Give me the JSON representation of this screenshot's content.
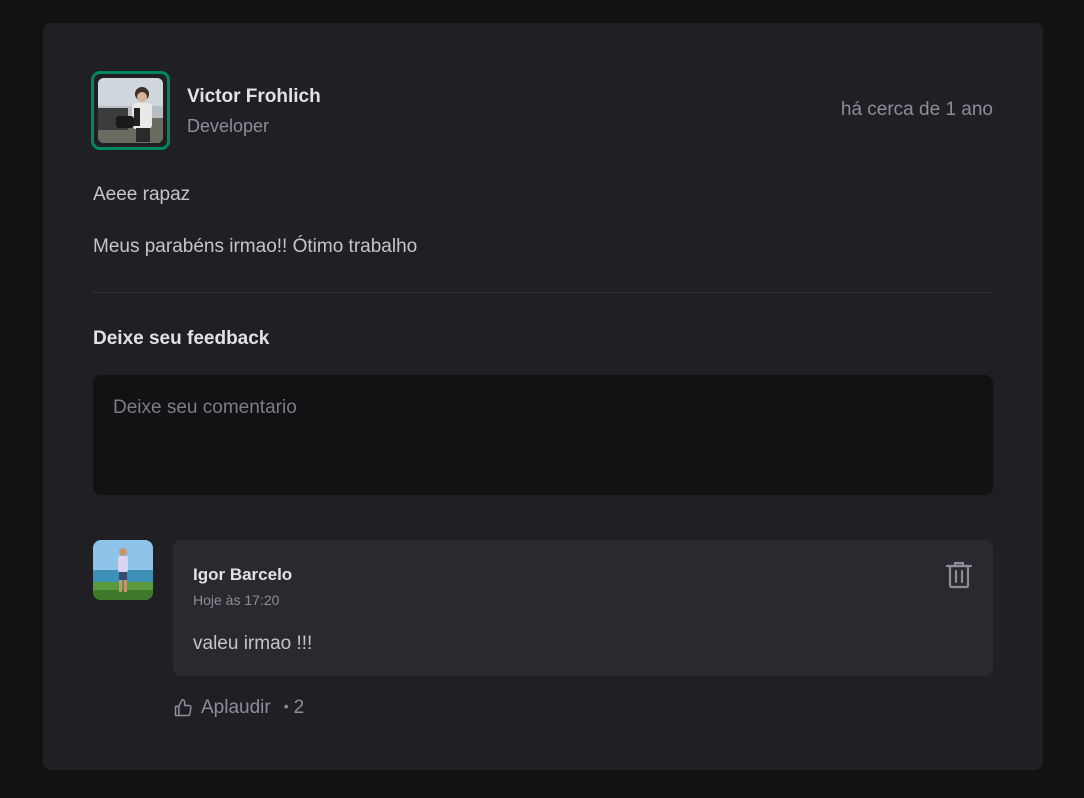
{
  "post": {
    "author": {
      "name": "Victor Frohlich",
      "role": "Developer"
    },
    "published_at": "há cerca de 1 ano",
    "content": [
      "Aeee rapaz",
      "Meus parabéns irmao!! Ótimo trabalho"
    ]
  },
  "feedback": {
    "title": "Deixe seu feedback",
    "placeholder": "Deixe seu comentario"
  },
  "comment": {
    "author": "Igor Barcelo",
    "time": "Hoje às 17:20",
    "text": "valeu irmao !!!",
    "applaud_label": "Aplaudir",
    "applaud_count": "2"
  },
  "colors": {
    "accent": "#00875f",
    "background": "#121214",
    "card": "#202024",
    "comment_box": "#29292e"
  }
}
